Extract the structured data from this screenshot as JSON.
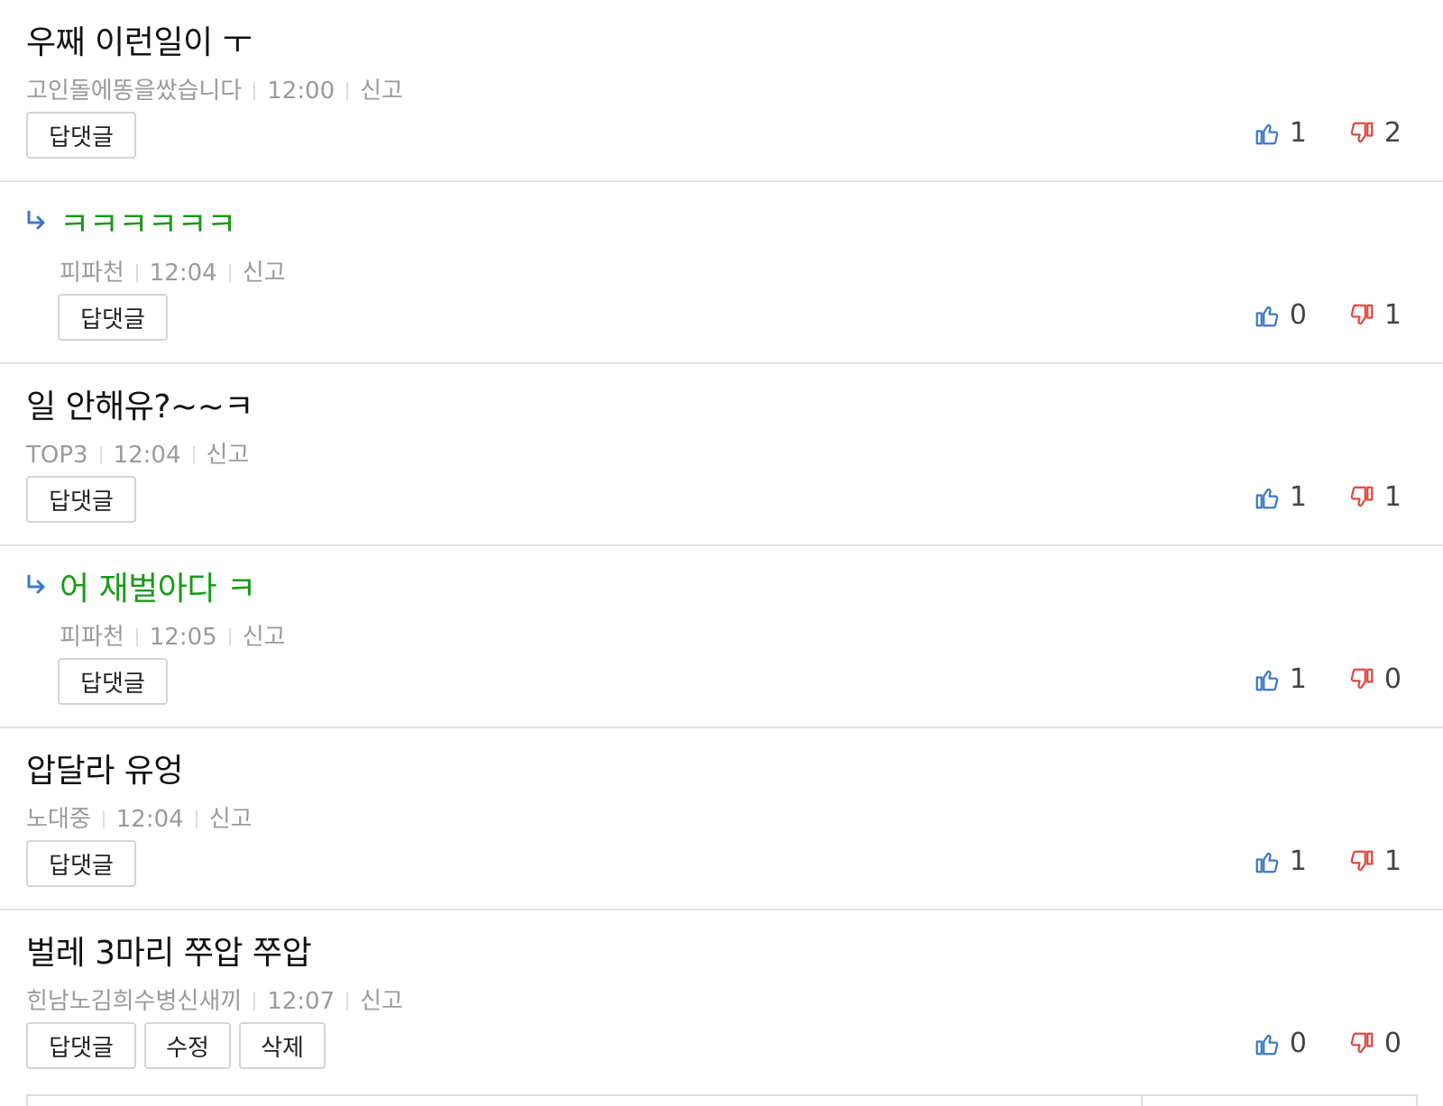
{
  "comments": [
    {
      "text": "우째 이런일이 ㅜ",
      "author": "고인돌에똥을쌌습니다",
      "time": "12:00",
      "report": "신고",
      "reply_label": "답댓글",
      "likes": "1",
      "dislikes": "2"
    },
    {
      "text": "ㅋㅋㅋㅋㅋㅋ",
      "author": "피파천",
      "time": "12:04",
      "report": "신고",
      "reply_label": "답댓글",
      "likes": "0",
      "dislikes": "1"
    },
    {
      "text": "일 안해유?~~ㅋ",
      "author": "TOP3",
      "time": "12:04",
      "report": "신고",
      "reply_label": "답댓글",
      "likes": "1",
      "dislikes": "1"
    },
    {
      "text": "어 재벌아다 ㅋ",
      "author": "피파천",
      "time": "12:05",
      "report": "신고",
      "reply_label": "답댓글",
      "likes": "1",
      "dislikes": "0"
    },
    {
      "text": "압달라 유엉",
      "author": "노대중",
      "time": "12:04",
      "report": "신고",
      "reply_label": "답댓글",
      "likes": "1",
      "dislikes": "1"
    },
    {
      "text": "벌레 3마리 쭈압 쭈압",
      "author": "힌남노김희수병신새끼",
      "time": "12:07",
      "report": "신고",
      "reply_label": "답댓글",
      "edit_label": "수정",
      "delete_label": "삭제",
      "likes": "0",
      "dislikes": "0"
    }
  ],
  "colors": {
    "like": "#3b78c9",
    "dislike": "#e0483f",
    "reply_text": "#1a9a1a",
    "reply_arrow": "#3b78c9"
  },
  "icons": {
    "like": "thumbs-up-icon",
    "dislike": "thumbs-down-icon",
    "reply": "reply-arrow-icon"
  }
}
